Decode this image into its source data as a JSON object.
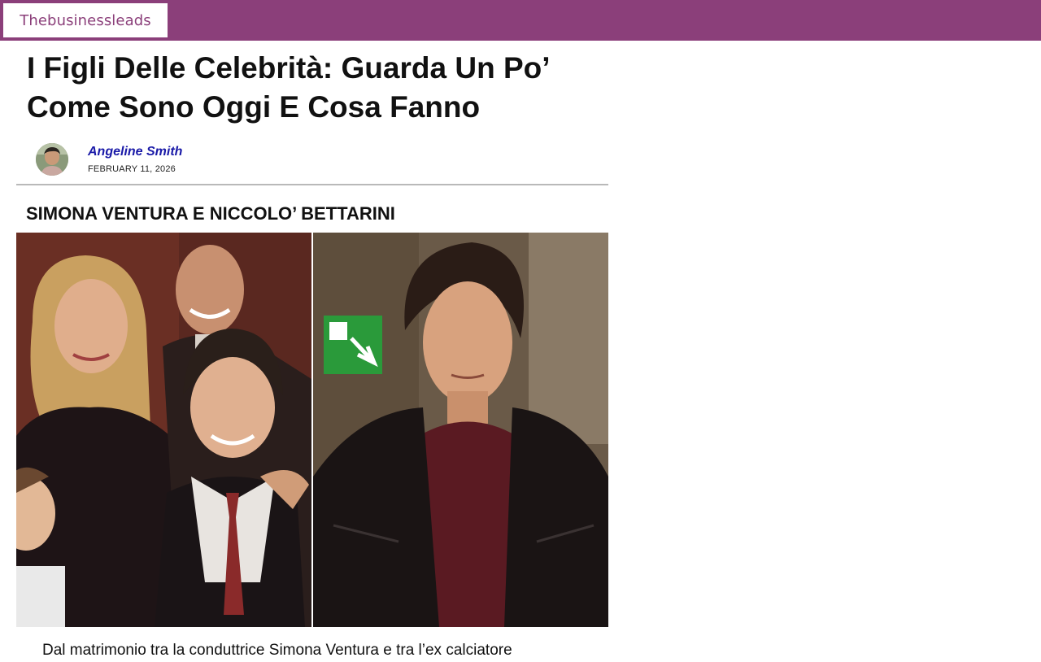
{
  "site": {
    "logo_text": "Thebusinessleads",
    "bar_color": "#8b3f7a"
  },
  "article": {
    "title": "I Figli Delle Celebrità: Guarda Un Po’ Come Sono Oggi E Cosa Fanno",
    "author": "Angeline Smith",
    "date": "FEBRUARY 11, 2026",
    "section_title": "SIMONA VENTURA E NICCOLO’ BETTARINI",
    "paragraph": "Dal matrimonio tra la conduttrice Simona Ventura e tra l’ex calciatore"
  },
  "colors": {
    "author_link": "#1a1aa8",
    "divider": "#b9b9b9"
  },
  "icons": {
    "avatar": "author-avatar",
    "exit_sign": "emergency-exit-sign"
  }
}
